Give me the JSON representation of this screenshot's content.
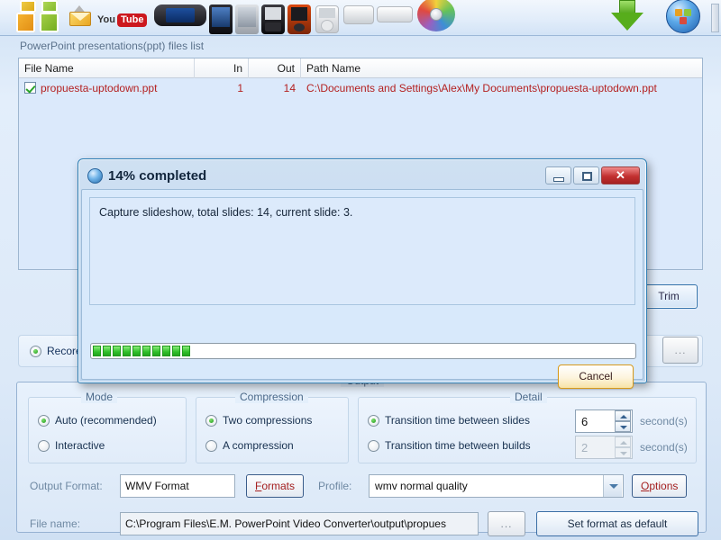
{
  "toolbar": {
    "icons": [
      "office-ppt-icon",
      "export-arrow-icon",
      "youtube-icon",
      "psp-device-icon",
      "phone-device-icon",
      "silver-phone-icon",
      "blackberry-device-icon",
      "red-phone-icon",
      "ipod-device-icon",
      "ipod-shuffle-icon",
      "ipod-nano-icon",
      "dvd-disc-icon"
    ],
    "right_icons": [
      "download-icon",
      "globe-icon"
    ],
    "scrollbar": "toolbar-scrollbar"
  },
  "file_list": {
    "label": "PowerPoint presentations(ppt) files list",
    "columns": [
      "File Name",
      "In",
      "Out",
      "Path Name"
    ],
    "rows": [
      {
        "checked": true,
        "file_name": "propuesta-uptodown.ppt",
        "in": "1",
        "out": "14",
        "path_name": "C:\\Documents and Settings\\Alex\\My Documents\\propuesta-uptodown.ppt"
      }
    ]
  },
  "middle": {
    "trim_label": "Trim",
    "record_label": "Recore",
    "dots_label": "..."
  },
  "output": {
    "legend": "Output",
    "mode": {
      "legend": "Mode",
      "options": [
        {
          "label": "Auto (recommended)",
          "selected": true
        },
        {
          "label": "Interactive",
          "selected": false
        }
      ]
    },
    "compression": {
      "legend": "Compression",
      "options": [
        {
          "label": "Two compressions",
          "selected": true
        },
        {
          "label": "A compression",
          "selected": false
        }
      ]
    },
    "detail": {
      "legend": "Detail",
      "options": [
        {
          "label": "Transition time between slides",
          "selected": true,
          "value": "6",
          "unit": "second(s)",
          "enabled": true
        },
        {
          "label": "Transition time between builds",
          "selected": false,
          "value": "2",
          "unit": "second(s)",
          "enabled": false
        }
      ]
    },
    "format_row": {
      "label": "Output Format:",
      "value": "WMV Format",
      "formats_button": "Formats",
      "formats_accel": "F",
      "profile_label": "Profile:",
      "profile_value": "wmv normal quality",
      "options_button": "Options",
      "options_accel": "O"
    },
    "file_row": {
      "label": "File name:",
      "value": "C:\\Program Files\\E.M. PowerPoint Video Converter\\output\\propues",
      "browse_button": "...",
      "default_button": "Set format as default"
    }
  },
  "dialog": {
    "title": "14% completed",
    "message": "Capture slideshow, total slides: 14, current slide: 3.",
    "progress_percent": 14,
    "progress_blocks": 10,
    "cancel_label": "Cancel",
    "window_buttons": [
      "minimize",
      "maximize",
      "close"
    ]
  },
  "colors": {
    "accent_blue": "#2f7fb5",
    "progress_green": "#2fbf2a",
    "list_text_red": "#b42121",
    "button_amber": "#d79a1b",
    "close_red": "#c23030"
  }
}
